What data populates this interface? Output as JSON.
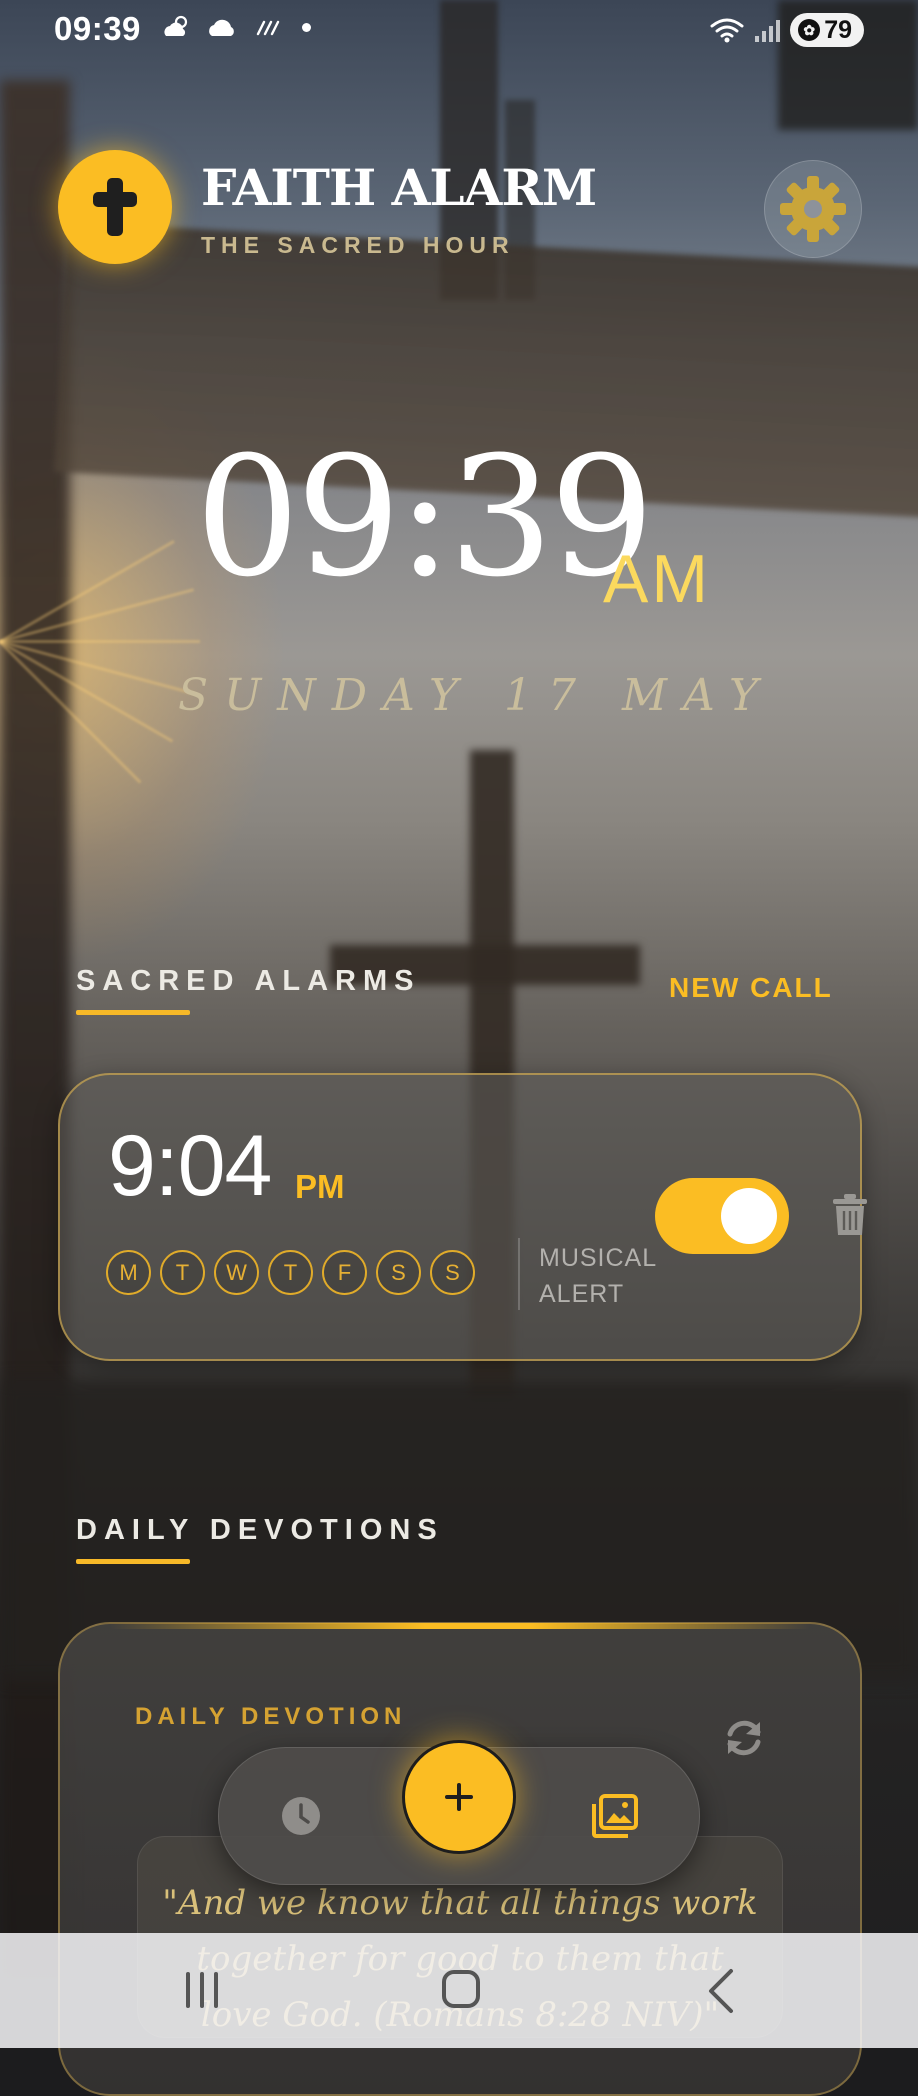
{
  "status_bar": {
    "time": "09:39",
    "icons": [
      "weather-icon",
      "cloud-icon",
      "rain-icon"
    ],
    "battery": "79"
  },
  "header": {
    "title": "FAITH ALARM",
    "subtitle": "THE SACRED HOUR"
  },
  "clock": {
    "time": "09:39",
    "ampm": "AM",
    "date": "SUNDAY 17 MAY"
  },
  "alarms_section": {
    "title": "SACRED ALARMS",
    "new_call_label": "NEW CALL"
  },
  "alarm": {
    "time": "9:04",
    "ampm": "PM",
    "days": [
      "M",
      "T",
      "W",
      "T",
      "F",
      "S",
      "S"
    ],
    "label": "MUSICAL ALERT",
    "enabled": true
  },
  "devotions_section": {
    "title": "DAILY DEVOTIONS"
  },
  "devotion": {
    "label": "DAILY DEVOTION",
    "verse": "\"And we know that all things work together for good to them that love God. (Romans 8:28 NIV)\""
  },
  "colors": {
    "accent": "#fbbd23",
    "accent_text": "#d5a232",
    "verse_text": "#d9c07a"
  }
}
